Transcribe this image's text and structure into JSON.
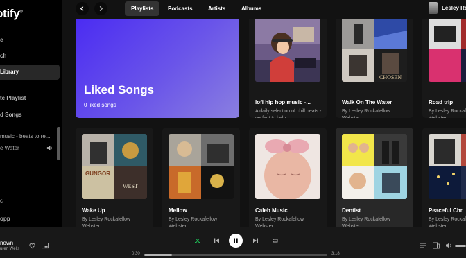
{
  "app": {
    "logo_text": "otify"
  },
  "sidebar": {
    "items": [
      {
        "label": "e",
        "active": false
      },
      {
        "label": "ch",
        "active": false
      },
      {
        "label": "Library",
        "active": true
      }
    ],
    "create_playlist": "te Playlist",
    "liked_songs": "d Songs",
    "playlists": [
      {
        "label": "music - beats to re..."
      },
      {
        "label": "e Water"
      }
    ],
    "extra_1": "c",
    "extra_2": "opp"
  },
  "topbar": {
    "tabs": [
      {
        "label": "Playlists",
        "active": true
      },
      {
        "label": "Podcasts",
        "active": false
      },
      {
        "label": "Artists",
        "active": false
      },
      {
        "label": "Albums",
        "active": false
      }
    ],
    "profile_name": "Lesley Rocka"
  },
  "liked": {
    "title": "Liked Songs",
    "subtitle": "0 liked songs"
  },
  "cards": [
    {
      "title": "lofi hip hop music -...",
      "desc": "A daily selection of chill beats - perfect to help..."
    },
    {
      "title": "Walk On The Water",
      "desc": "By Lesley Rockafellow Webster"
    },
    {
      "title": "Road trip",
      "desc": "By Lesley Rockafellow Webster"
    },
    {
      "title": "Wake Up",
      "desc": "By Lesley Rockafellow Webster"
    },
    {
      "title": "Mellow",
      "desc": "By Lesley Rockafellow Webster"
    },
    {
      "title": "Caleb Music",
      "desc": "By Lesley Rockafellow Webster"
    },
    {
      "title": "Dentist",
      "desc": "By Lesley Rockafellow Webster"
    },
    {
      "title": "Peaceful Chr",
      "desc": "By Lesley Rockafellow Webster"
    }
  ],
  "player": {
    "track_title": "nown",
    "track_artist": "uren Wells",
    "elapsed": "0:30",
    "duration": "3:18",
    "progress_fraction": 0.15
  },
  "colors": {
    "accent_green": "#1db954",
    "liked_gradient_start": "#4b2cf2",
    "liked_gradient_end": "#8a7fe0"
  }
}
